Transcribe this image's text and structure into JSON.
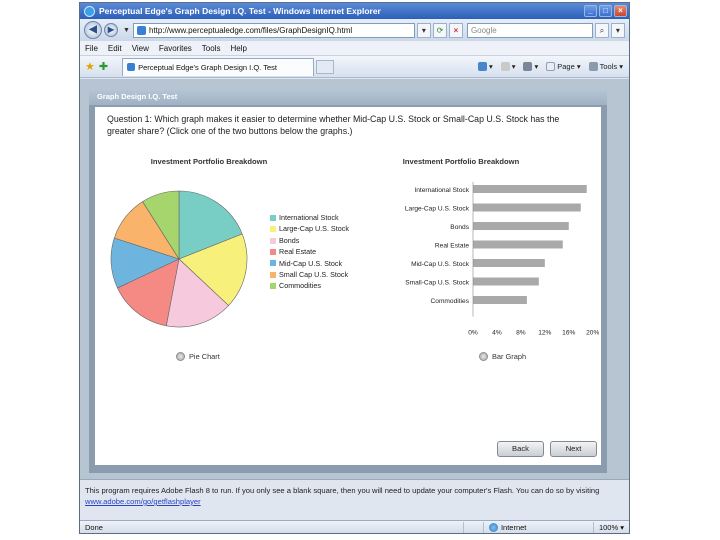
{
  "window": {
    "title": "Perceptual Edge's Graph Design I.Q. Test - Windows Internet Explorer"
  },
  "address_bar": {
    "url": "http://www.perceptualedge.com/files/GraphDesignIQ.html",
    "search_placeholder": "Google"
  },
  "menu": {
    "items": [
      "File",
      "Edit",
      "View",
      "Favorites",
      "Tools",
      "Help"
    ]
  },
  "tabs": {
    "active_tab": "Perceptual Edge's Graph Design I.Q. Test"
  },
  "command_bar": {
    "page_label": "Page",
    "tools_label": "Tools"
  },
  "app": {
    "header": "Graph Design I.Q. Test",
    "question": "Question 1: Which graph makes it easier to determine whether Mid-Cap U.S. Stock or Small-Cap U.S. Stock has the greater share? (Click one of the two buttons below the graphs.)",
    "pie_option": "Pie Chart",
    "bar_option": "Bar Graph",
    "back_label": "Back",
    "next_label": "Next"
  },
  "chart_data": [
    {
      "type": "pie",
      "title": "Investment Portfolio Breakdown",
      "categories": [
        "International Stock",
        "Large-Cap U.S. Stock",
        "Bonds",
        "Real Estate",
        "Mid-Cap U.S. Stock",
        "Small Cap U.S. Stock",
        "Commodities"
      ],
      "values": [
        19,
        18,
        16,
        15,
        12,
        11,
        9
      ],
      "colors": [
        "#78cdc5",
        "#f7f07a",
        "#f6c9dc",
        "#f58a84",
        "#6db5de",
        "#f9b36b",
        "#a7d56d"
      ],
      "legend": "right"
    },
    {
      "type": "bar",
      "orientation": "horizontal",
      "title": "Investment Portfolio Breakdown",
      "categories": [
        "International Stock",
        "Large-Cap U.S. Stock",
        "Bonds",
        "Real Estate",
        "Mid-Cap U.S. Stock",
        "Small-Cap U.S. Stock",
        "Commodities"
      ],
      "values": [
        19,
        18,
        16,
        15,
        12,
        11,
        9
      ],
      "tick_labels": [
        "0%",
        "4%",
        "8%",
        "12%",
        "16%",
        "20%"
      ],
      "xlim": [
        0,
        20
      ],
      "bar_color": "#a9a9a9",
      "grid": false
    }
  ],
  "notice": {
    "text": "This program requires Adobe Flash 8 to run. If you only see a blank square, then you will need to update your computer's Flash. You can do so by visiting ",
    "link_text": "www.adobe.com/go/getflashplayer"
  },
  "status": {
    "text": "Done",
    "zone": "Internet",
    "zoom": "100%"
  }
}
